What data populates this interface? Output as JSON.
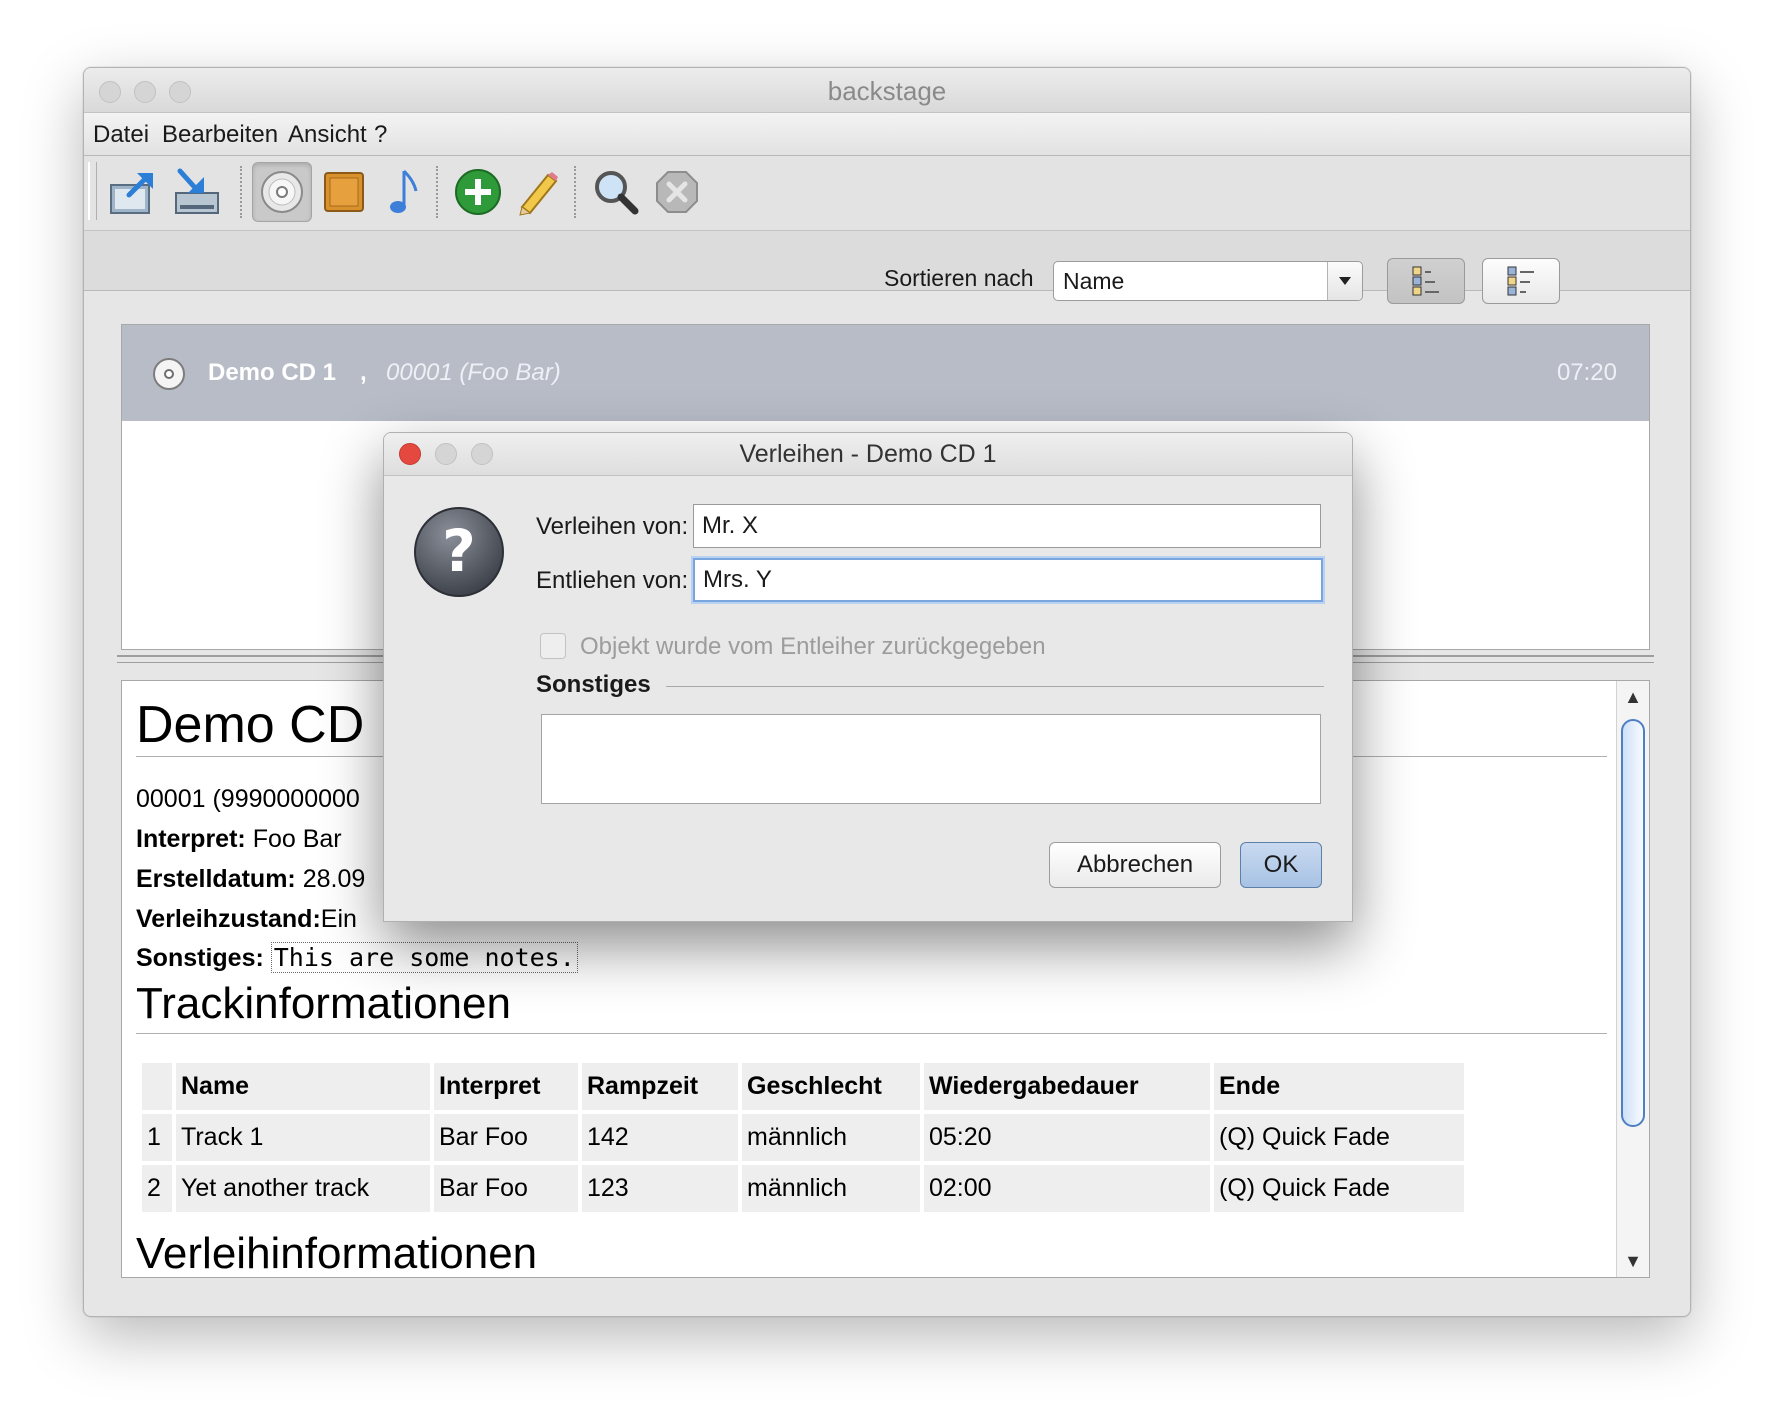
{
  "window": {
    "title": "backstage"
  },
  "menu": [
    "Datei",
    "Bearbeiten",
    "Ansicht",
    "?"
  ],
  "toolbar": {
    "icons": [
      "open-icon",
      "import-icon",
      "cd-icon",
      "box-icon",
      "music-note-icon",
      "add-icon",
      "edit-icon",
      "search-icon",
      "delete-icon"
    ]
  },
  "sort": {
    "label": "Sortieren nach",
    "selected": "Name"
  },
  "list": {
    "items": [
      {
        "name": "Demo CD 1",
        "separator": ",",
        "subtitle": "00001 (Foo Bar)",
        "duration": "07:20"
      }
    ]
  },
  "detail": {
    "title": "Demo CD",
    "id_line": "00001 (9990000000",
    "interpret_label": "Interpret:",
    "interpret_value": "Foo Bar",
    "created_label": "Erstelldatum:",
    "created_value": "28.09",
    "state_label": "Verleihzustand:",
    "state_value": "Ein",
    "notes_label": "Sonstiges:",
    "notes_value": "This are some notes.",
    "tracks_heading": "Trackinformationen",
    "tracks": {
      "columns": [
        "",
        "Name",
        "Interpret",
        "Rampzeit",
        "Geschlecht",
        "Wiedergabedauer",
        "Ende"
      ],
      "rows": [
        [
          "1",
          "Track 1",
          "Bar Foo",
          "142",
          "männlich",
          "05:20",
          "(Q) Quick Fade"
        ],
        [
          "2",
          "Yet another track",
          "Bar Foo",
          "123",
          "männlich",
          "02:00",
          "(Q) Quick Fade"
        ]
      ]
    },
    "lend_heading": "Verleihinformationen"
  },
  "dialog": {
    "title": "Verleihen - Demo CD 1",
    "lent_by_label": "Verleihen von:",
    "lent_by_value": "Mr. X",
    "borrowed_by_label": "Entliehen von:",
    "borrowed_by_value": "Mrs. Y",
    "returned_label": "Objekt wurde vom Entleiher zurückgegeben",
    "misc_label": "Sonstiges",
    "misc_value": "",
    "cancel_label": "Abbrechen",
    "ok_label": "OK"
  },
  "colors": {
    "list_selection": "#b7bcc7",
    "ok_button": "#a7c2e4",
    "close_button": "#e5483f",
    "scroll_thumb_border": "#4e7fc5"
  }
}
